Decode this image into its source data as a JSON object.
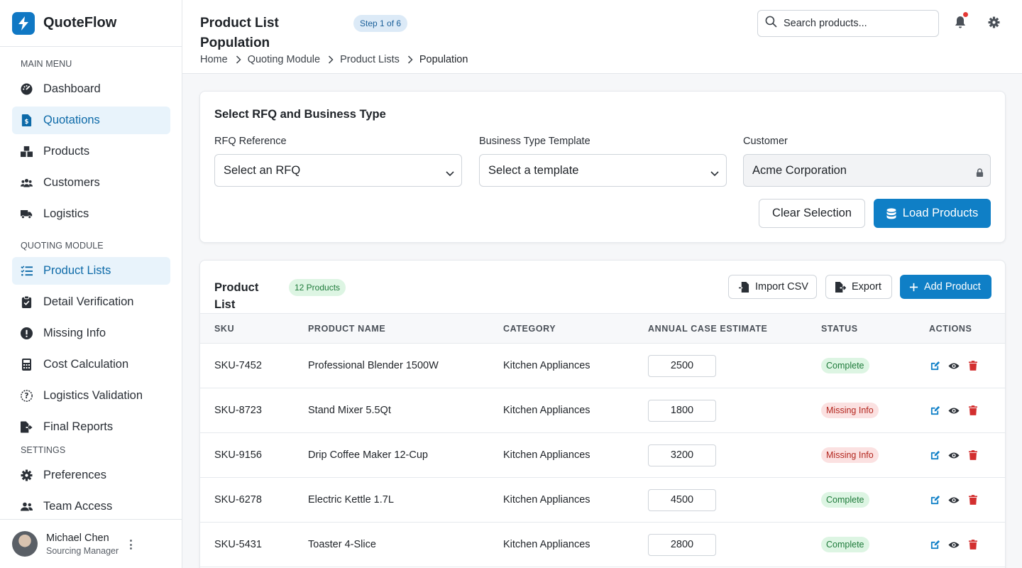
{
  "app": {
    "name": "QuoteFlow"
  },
  "sidebar": {
    "main_menu_label": "MAIN MENU",
    "main_items": [
      {
        "label": "Dashboard",
        "icon": "dashboard-gauge-icon"
      },
      {
        "label": "Quotations",
        "icon": "file-dollar-icon",
        "active": true
      },
      {
        "label": "Products",
        "icon": "boxes-icon"
      },
      {
        "label": "Customers",
        "icon": "users-icon"
      },
      {
        "label": "Logistics",
        "icon": "truck-icon"
      }
    ],
    "quoting_label": "QUOTING MODULE",
    "quoting_items": [
      {
        "label": "Product Lists",
        "icon": "list-check-icon",
        "active": true
      },
      {
        "label": "Detail Verification",
        "icon": "clipboard-check-icon"
      },
      {
        "label": "Missing Info",
        "icon": "exclamation-circle-icon"
      },
      {
        "label": "Cost Calculation",
        "icon": "calculator-icon"
      },
      {
        "label": "Logistics Validation",
        "icon": "question-circle-icon"
      },
      {
        "label": "Final Reports",
        "icon": "file-export-icon"
      }
    ],
    "settings_label": "SETTINGS",
    "settings_items": [
      {
        "label": "Preferences",
        "icon": "gear-icon"
      },
      {
        "label": "Team Access",
        "icon": "users-icon"
      }
    ],
    "user": {
      "name": "Michael Chen",
      "role": "Sourcing Manager"
    }
  },
  "header": {
    "title": "Product List Population",
    "step": "Step 1 of 6",
    "search_placeholder": "Search products...",
    "breadcrumb": [
      "Home",
      "Quoting Module",
      "Product Lists",
      "Population"
    ]
  },
  "selection": {
    "title": "Select RFQ and Business Type",
    "rfq_label": "RFQ Reference",
    "rfq_value": "Select an RFQ",
    "template_label": "Business Type Template",
    "template_value": "Select a template",
    "customer_label": "Customer",
    "customer_value": "Acme Corporation",
    "clear_label": "Clear Selection",
    "load_label": "Load Products"
  },
  "product_list": {
    "title": "Product List",
    "count": "12 Products",
    "import_label": "Import CSV",
    "export_label": "Export",
    "add_label": "Add Product",
    "columns": [
      "SKU",
      "PRODUCT NAME",
      "CATEGORY",
      "ANNUAL CASE ESTIMATE",
      "STATUS",
      "ACTIONS"
    ],
    "rows": [
      {
        "sku": "SKU-7452",
        "name": "Professional Blender 1500W",
        "category": "Kitchen Appliances",
        "estimate": "2500",
        "status": "Complete"
      },
      {
        "sku": "SKU-8723",
        "name": "Stand Mixer 5.5Qt",
        "category": "Kitchen Appliances",
        "estimate": "1800",
        "status": "Missing Info"
      },
      {
        "sku": "SKU-9156",
        "name": "Drip Coffee Maker 12-Cup",
        "category": "Kitchen Appliances",
        "estimate": "3200",
        "status": "Missing Info"
      },
      {
        "sku": "SKU-6278",
        "name": "Electric Kettle 1.7L",
        "category": "Kitchen Appliances",
        "estimate": "4500",
        "status": "Complete"
      },
      {
        "sku": "SKU-5431",
        "name": "Toaster 4-Slice",
        "category": "Kitchen Appliances",
        "estimate": "2800",
        "status": "Complete"
      }
    ]
  },
  "colors": {
    "primary": "#0f7fc6",
    "active_bg": "#e8f3fb",
    "complete": "#1e7a3a",
    "missing": "#b3261e",
    "notification": "#e53935"
  }
}
